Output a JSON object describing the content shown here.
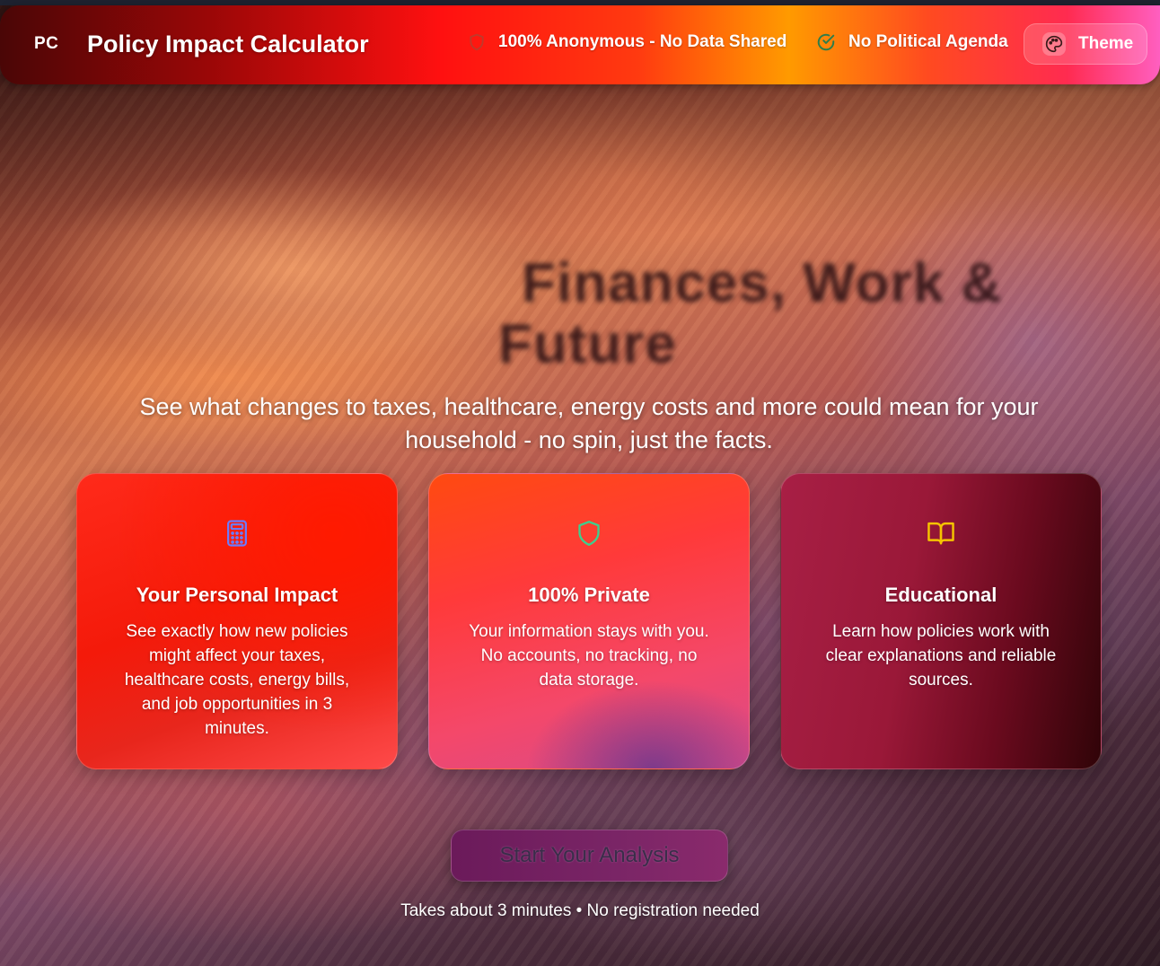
{
  "header": {
    "logo": "PC",
    "title": "Policy Impact Calculator",
    "badges": [
      {
        "label": "100% Anonymous - No Data Shared",
        "icon": "shield-icon",
        "icon_color": "#c0392b"
      },
      {
        "label": "No Political Agenda",
        "icon": "check-circle-icon",
        "icon_color": "#2f7d4a"
      }
    ],
    "theme_button": {
      "label": "Theme",
      "icon": "palette-icon"
    }
  },
  "hero": {
    "heading_line1": "Finances, Work &",
    "heading_line2": "Future",
    "subtitle": "See what changes to taxes, healthcare, energy costs and more could mean for your household - no spin, just the facts."
  },
  "cards": [
    {
      "icon": "calculator-icon",
      "icon_color": "#6b7cff",
      "title": "Your Personal Impact",
      "text": "See exactly how new policies might affect your taxes, healthcare costs, energy bills, and job opportunities in 3 minutes."
    },
    {
      "icon": "shield-icon",
      "icon_color": "#3ecf8e",
      "title": "100% Private",
      "text": "Your information stays with you. No accounts, no tracking, no data storage."
    },
    {
      "icon": "book-open-icon",
      "icon_color": "#f5c400",
      "title": "Educational",
      "text": "Learn how policies work with clear explanations and reliable sources."
    }
  ],
  "cta": {
    "label": "Start Your Analysis",
    "footnote": "Takes about 3 minutes • No registration needed"
  }
}
